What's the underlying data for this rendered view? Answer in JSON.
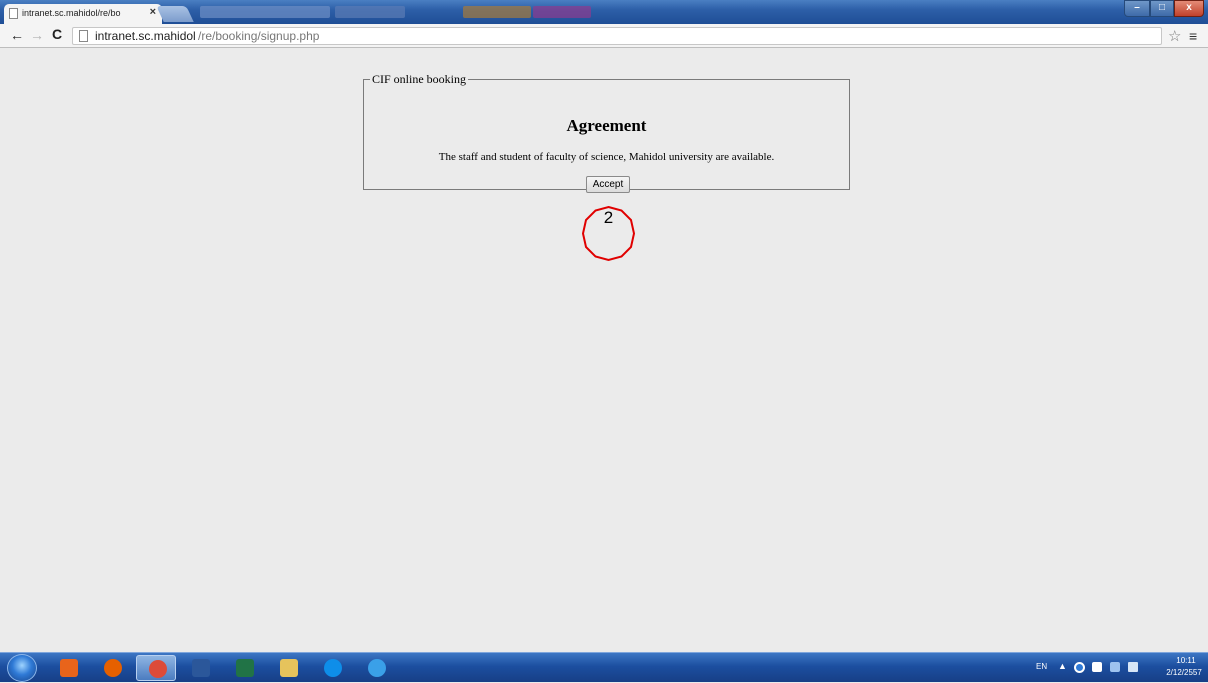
{
  "browser": {
    "tab_title": "intranet.sc.mahidol/re/bo",
    "tab_close": "×",
    "url_host": "intranet.sc.mahidol",
    "url_path": "/re/booking/signup.php",
    "back_glyph": "←",
    "forward_glyph": "→",
    "reload_glyph": "C",
    "star_glyph": "☆",
    "menu_glyph": "≡",
    "window_controls": {
      "minimize": "–",
      "maximize": "□",
      "close": "x"
    }
  },
  "page": {
    "legend": "CIF online booking",
    "heading": "Agreement",
    "text": "The staff and student of faculty of science, Mahidol university are available.",
    "accept_label": "Accept"
  },
  "annotation": {
    "label": "2",
    "color": "#e00000"
  },
  "taskbar": {
    "apps": [
      {
        "name": "media-player-icon",
        "color": "#e8641b"
      },
      {
        "name": "firefox-icon",
        "color": "#e66000"
      },
      {
        "name": "chrome-icon",
        "color": "#dd4b39"
      },
      {
        "name": "word-icon",
        "color": "#2b579a"
      },
      {
        "name": "excel-icon",
        "color": "#217346"
      },
      {
        "name": "file-explorer-icon",
        "color": "#e6c35c"
      },
      {
        "name": "teamviewer-icon",
        "color": "#0e8ee9"
      },
      {
        "name": "internet-explorer-icon",
        "color": "#3aa0e8"
      }
    ],
    "language": "EN",
    "tray_arrow": "▲",
    "time": "10:11",
    "date": "2/12/2557"
  }
}
